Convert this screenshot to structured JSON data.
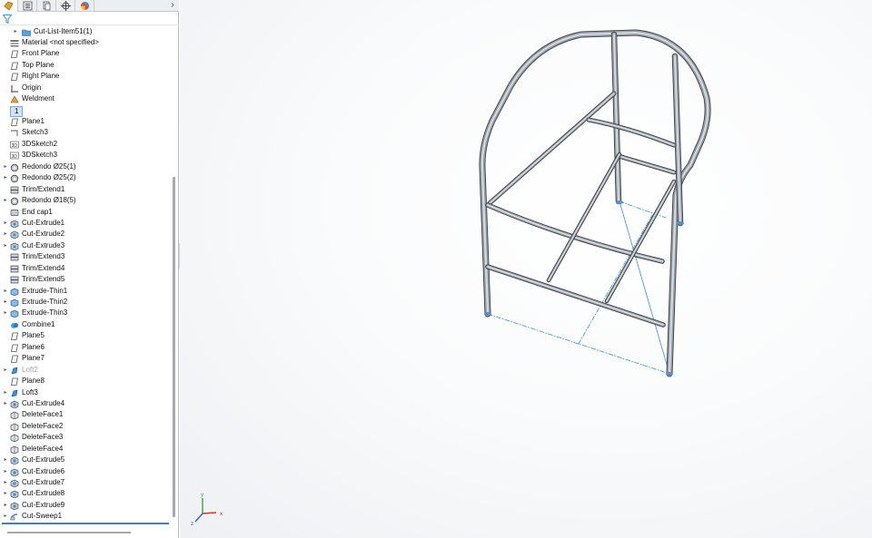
{
  "tabs": [
    {
      "name": "featuremanager-tab",
      "icon": "part-icon"
    },
    {
      "name": "propertymanager-tab",
      "icon": "property-list-icon"
    },
    {
      "name": "configurationmanager-tab",
      "icon": "configuration-icon"
    },
    {
      "name": "dimxpert-tab",
      "icon": "crosshair-icon"
    },
    {
      "name": "display-manager-tab",
      "icon": "appearance-sphere-icon"
    }
  ],
  "tab_more": "›",
  "tree": [
    {
      "label": "Cut-List-Item51(1)",
      "icon": "folder-icon",
      "expand": true,
      "first": true
    },
    {
      "label": "Material <not specified>",
      "icon": "material-icon"
    },
    {
      "label": "Front Plane",
      "icon": "plane-icon"
    },
    {
      "label": "Top Plane",
      "icon": "plane-icon"
    },
    {
      "label": "Right Plane",
      "icon": "plane-icon"
    },
    {
      "label": "Origin",
      "icon": "origin-icon"
    },
    {
      "label": "Weldment",
      "icon": "weldment-icon"
    },
    {
      "label": "1",
      "icon": "",
      "selected": true
    },
    {
      "label": "Plane1",
      "icon": "plane-icon"
    },
    {
      "label": "Sketch3",
      "icon": "sketch-icon"
    },
    {
      "label": "3DSketch2",
      "icon": "3dsketch-icon"
    },
    {
      "label": "3DSketch3",
      "icon": "3dsketch-icon"
    },
    {
      "label": "Redondo Ø25(1)",
      "icon": "structural-member-icon",
      "expand": true
    },
    {
      "label": "Redondo Ø25(2)",
      "icon": "structural-member-icon",
      "expand": true
    },
    {
      "label": "Trim/Extend1",
      "icon": "trim-extend-icon"
    },
    {
      "label": "Redondo Ø18(5)",
      "icon": "structural-member-icon",
      "expand": true
    },
    {
      "label": "End cap1",
      "icon": "end-cap-icon"
    },
    {
      "label": "Cut-Extrude1",
      "icon": "cut-extrude-icon",
      "expand": true
    },
    {
      "label": "Cut-Extrude2",
      "icon": "cut-extrude-icon",
      "expand": true
    },
    {
      "label": "Cut-Extrude3",
      "icon": "cut-extrude-icon",
      "expand": true
    },
    {
      "label": "Trim/Extend3",
      "icon": "trim-extend-icon"
    },
    {
      "label": "Trim/Extend4",
      "icon": "trim-extend-icon"
    },
    {
      "label": "Trim/Extend5",
      "icon": "trim-extend-icon"
    },
    {
      "label": "Extrude-Thin1",
      "icon": "extrude-icon",
      "expand": true
    },
    {
      "label": "Extrude-Thin2",
      "icon": "extrude-icon",
      "expand": true
    },
    {
      "label": "Extrude-Thin3",
      "icon": "extrude-icon",
      "expand": true
    },
    {
      "label": "Combine1",
      "icon": "combine-icon"
    },
    {
      "label": "Plane5",
      "icon": "plane-icon"
    },
    {
      "label": "Plane6",
      "icon": "plane-icon"
    },
    {
      "label": "Plane7",
      "icon": "plane-icon"
    },
    {
      "label": "Loft2",
      "icon": "loft-icon",
      "expand": true,
      "dim": true
    },
    {
      "label": "Plane8",
      "icon": "plane-icon"
    },
    {
      "label": "Loft3",
      "icon": "loft-icon",
      "expand": true
    },
    {
      "label": "Cut-Extrude4",
      "icon": "cut-extrude-icon",
      "expand": true
    },
    {
      "label": "DeleteFace1",
      "icon": "delete-face-icon"
    },
    {
      "label": "DeleteFace2",
      "icon": "delete-face-icon"
    },
    {
      "label": "DeleteFace3",
      "icon": "delete-face-icon"
    },
    {
      "label": "DeleteFace4",
      "icon": "delete-face-icon"
    },
    {
      "label": "Cut-Extrude5",
      "icon": "cut-extrude-icon",
      "expand": true
    },
    {
      "label": "Cut-Extrude6",
      "icon": "cut-extrude-icon",
      "expand": true
    },
    {
      "label": "Cut-Extrude7",
      "icon": "cut-extrude-icon",
      "expand": true
    },
    {
      "label": "Cut-Extrude8",
      "icon": "cut-extrude-icon",
      "expand": true
    },
    {
      "label": "Cut-Extrude9",
      "icon": "cut-extrude-icon",
      "expand": true
    },
    {
      "label": "Cut-Sweep1",
      "icon": "cut-sweep-icon",
      "expand": true
    }
  ],
  "triad_labels": {
    "x": "x",
    "y": "y",
    "z": "z"
  },
  "colors": {
    "tube": "#9aa0a8",
    "tube_edge": "#3c4047",
    "sketch": "#3b8fd6",
    "selection": "#cfe3fb"
  }
}
